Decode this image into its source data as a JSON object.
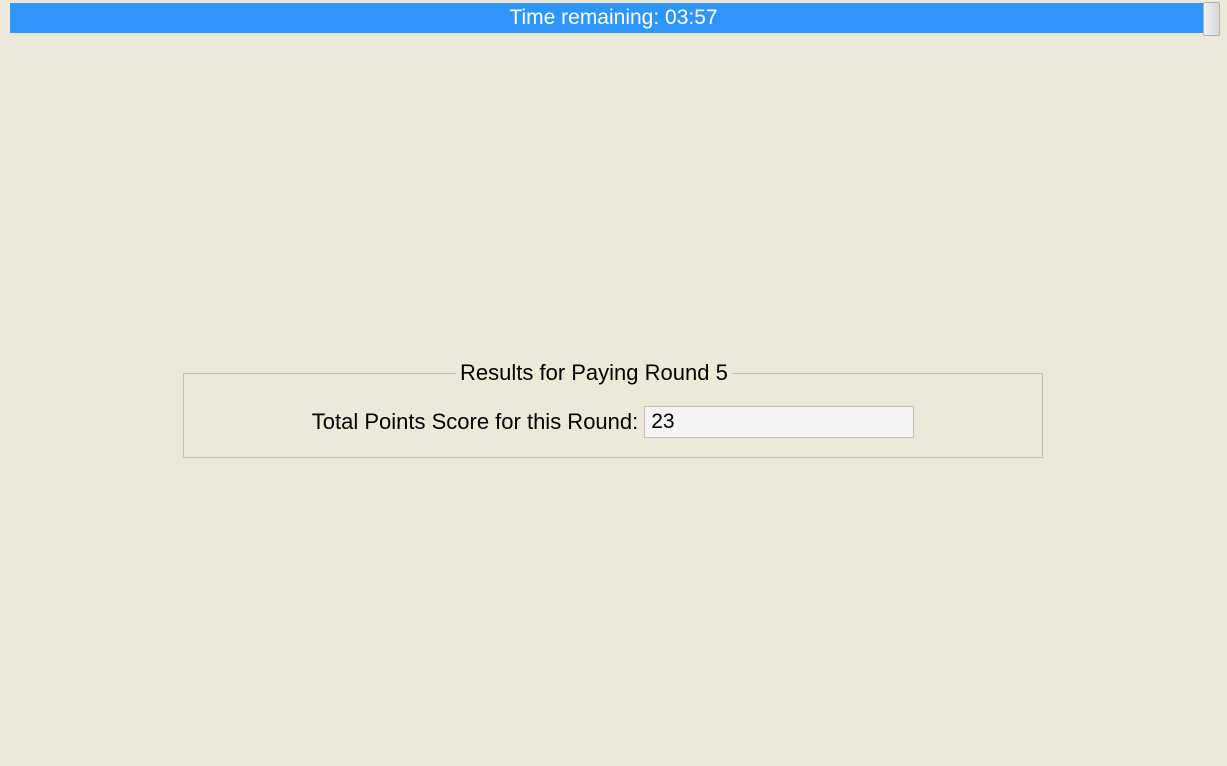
{
  "timer": {
    "label": "Time remaining: 03:57"
  },
  "results": {
    "legend": "Results for Paying Round 5",
    "score_label": "Total Points Score for this Round:",
    "score_value": "23"
  }
}
